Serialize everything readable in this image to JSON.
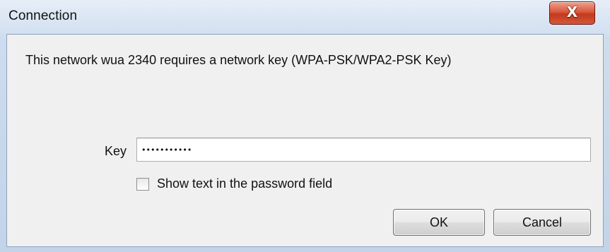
{
  "window": {
    "title": "Connection",
    "close_glyph": "X"
  },
  "dialog": {
    "message": "This network wua 2340 requires a network key (WPA-PSK/WPA2-PSK Key)",
    "key_label": "Key",
    "key_value": "•••••••••••",
    "show_text_label": "Show text in the password field",
    "show_text_checked": false,
    "ok_label": "OK",
    "cancel_label": "Cancel"
  },
  "colors": {
    "close_button": "#c23a1d",
    "client_background": "#f0f0f0",
    "frame": "#cddcee"
  }
}
